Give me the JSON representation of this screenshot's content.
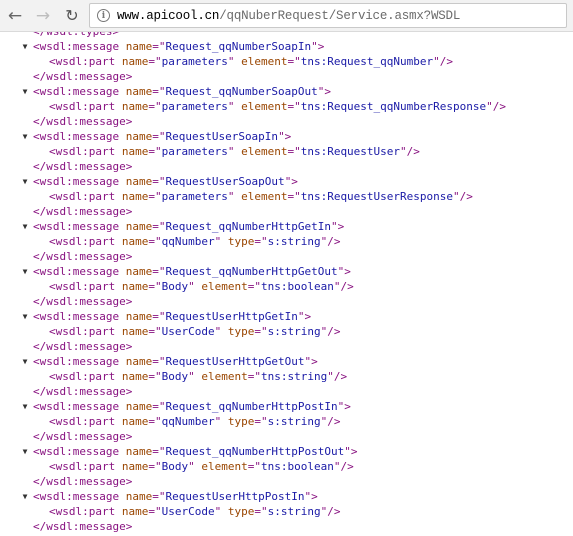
{
  "browser": {
    "url_host": "www.apicool.cn",
    "url_path": "/qqNuberRequest/Service.asmx?WSDL",
    "info_icon": "i"
  },
  "top_partial_line": "</wsdl:types>",
  "messages": [
    {
      "name": "Request_qqNumberSoapIn",
      "part": {
        "name": "parameters",
        "attr": "element",
        "value": "tns:Request_qqNumber"
      }
    },
    {
      "name": "Request_qqNumberSoapOut",
      "part": {
        "name": "parameters",
        "attr": "element",
        "value": "tns:Request_qqNumberResponse"
      }
    },
    {
      "name": "RequestUserSoapIn",
      "part": {
        "name": "parameters",
        "attr": "element",
        "value": "tns:RequestUser"
      }
    },
    {
      "name": "RequestUserSoapOut",
      "part": {
        "name": "parameters",
        "attr": "element",
        "value": "tns:RequestUserResponse"
      }
    },
    {
      "name": "Request_qqNumberHttpGetIn",
      "part": {
        "name": "qqNumber",
        "attr": "type",
        "value": "s:string"
      }
    },
    {
      "name": "Request_qqNumberHttpGetOut",
      "part": {
        "name": "Body",
        "attr": "element",
        "value": "tns:boolean"
      }
    },
    {
      "name": "RequestUserHttpGetIn",
      "part": {
        "name": "UserCode",
        "attr": "type",
        "value": "s:string"
      }
    },
    {
      "name": "RequestUserHttpGetOut",
      "part": {
        "name": "Body",
        "attr": "element",
        "value": "tns:string"
      }
    },
    {
      "name": "Request_qqNumberHttpPostIn",
      "part": {
        "name": "qqNumber",
        "attr": "type",
        "value": "s:string"
      }
    },
    {
      "name": "Request_qqNumberHttpPostOut",
      "part": {
        "name": "Body",
        "attr": "element",
        "value": "tns:boolean"
      }
    },
    {
      "name": "RequestUserHttpPostIn",
      "part": {
        "name": "UserCode",
        "attr": "type",
        "value": "s:string"
      }
    }
  ],
  "syntax_colors": {
    "tag": "#881280",
    "attribute": "#994500",
    "value": "#1a1aa6"
  }
}
